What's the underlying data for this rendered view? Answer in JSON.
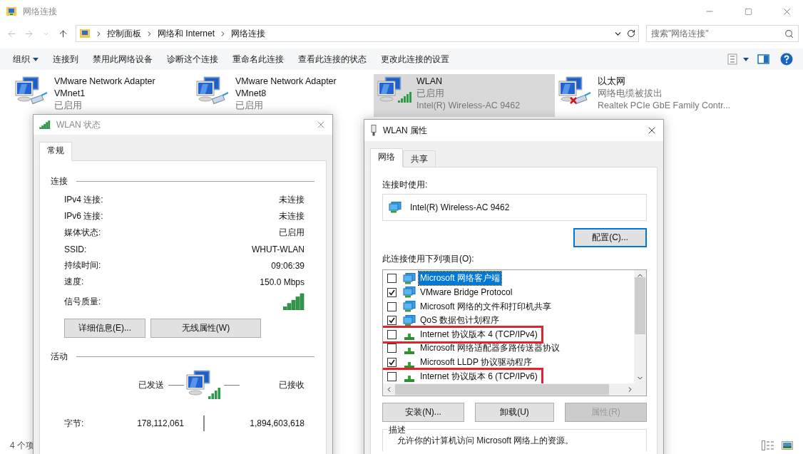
{
  "window": {
    "title": "网络连接"
  },
  "address": {
    "crumbs": [
      "控制面板",
      "网络和 Internet",
      "网络连接"
    ]
  },
  "search": {
    "placeholder": "搜索\"网络连接\""
  },
  "commands": [
    {
      "label": "组织",
      "kind": "menu"
    },
    {
      "label": "连接到",
      "kind": "plain"
    },
    {
      "label": "禁用此网络设备",
      "kind": "plain"
    },
    {
      "label": "诊断这个连接",
      "kind": "plain"
    },
    {
      "label": "重命名此连接",
      "kind": "plain"
    },
    {
      "label": "查看此连接的状态",
      "kind": "plain"
    },
    {
      "label": "更改此连接的设置",
      "kind": "plain"
    }
  ],
  "adapters": [
    {
      "name": "VMware Network Adapter VMnet1",
      "status": "已启用",
      "kind": "wired",
      "unplugged": false,
      "selected": false
    },
    {
      "name": "VMware Network Adapter VMnet8",
      "status": "已启用",
      "kind": "wired",
      "unplugged": false,
      "selected": false
    },
    {
      "name": "WLAN",
      "status": "已启用",
      "device": "Intel(R) Wireless-AC 9462",
      "kind": "wireless",
      "unplugged": false,
      "selected": true
    },
    {
      "name": "以太网",
      "status": "网络电缆被拔出",
      "device": "Realtek PCIe GbE Family Contr...",
      "kind": "wired",
      "unplugged": true,
      "selected": false
    }
  ],
  "status_bar": {
    "item_count": "4 个项"
  },
  "status_dialog": {
    "title": "WLAN 状态",
    "tabs": [
      {
        "label": "常规",
        "selected": true
      }
    ],
    "connection": {
      "heading": "连接",
      "rows": [
        {
          "label": "IPv4 连接:",
          "value": "未连接"
        },
        {
          "label": "IPv6 连接:",
          "value": "未连接"
        },
        {
          "label": "媒体状态:",
          "value": "已启用"
        },
        {
          "label": "SSID:",
          "value": "WHUT-WLAN"
        },
        {
          "label": "持续时间:",
          "value": "09:06:39"
        },
        {
          "label": "速度:",
          "value": "150.0 Mbps"
        }
      ],
      "signal_label": "信号质量:"
    },
    "buttons": [
      "详细信息(E)...",
      "无线属性(W)"
    ],
    "activity": {
      "heading": "活动",
      "sent_label": "已发送",
      "received_label": "已接收",
      "bytes_label": "字节:",
      "sent": "178,112,061",
      "received": "1,894,603,618"
    }
  },
  "properties_dialog": {
    "title": "WLAN 属性",
    "tabs": [
      {
        "label": "网络",
        "selected": true
      },
      {
        "label": "共享",
        "selected": false
      }
    ],
    "connect_using_label": "连接时使用:",
    "adapter": "Intel(R) Wireless-AC 9462",
    "configure_button": "配置(C)...",
    "items_label": "此连接使用下列项目(O):",
    "items": [
      {
        "label": "Microsoft 网络客户端",
        "kind": "service",
        "checked": false,
        "selected": true,
        "highlighted": false
      },
      {
        "label": "VMware Bridge Protocol",
        "kind": "service",
        "checked": true,
        "selected": false,
        "highlighted": false
      },
      {
        "label": "Microsoft 网络的文件和打印机共享",
        "kind": "service",
        "checked": false,
        "selected": false,
        "highlighted": false
      },
      {
        "label": "QoS 数据包计划程序",
        "kind": "service",
        "checked": true,
        "selected": false,
        "highlighted": false
      },
      {
        "label": "Internet 协议版本 4 (TCP/IPv4)",
        "kind": "protocol",
        "checked": false,
        "selected": false,
        "highlighted": true
      },
      {
        "label": "Microsoft 网络适配器多路传送器协议",
        "kind": "protocol",
        "checked": false,
        "selected": false,
        "highlighted": false
      },
      {
        "label": "Microsoft LLDP 协议驱动程序",
        "kind": "protocol",
        "checked": true,
        "selected": false,
        "highlighted": false
      },
      {
        "label": "Internet 协议版本 6 (TCP/IPv6)",
        "kind": "protocol",
        "checked": false,
        "selected": false,
        "highlighted": true
      }
    ],
    "buttons": [
      {
        "label": "安装(N)...",
        "disabled": false
      },
      {
        "label": "卸载(U)",
        "disabled": false
      },
      {
        "label": "属性(R)",
        "disabled": true
      }
    ],
    "description": {
      "heading": "描述",
      "text": "允许你的计算机访问 Microsoft 网络上的资源。"
    }
  }
}
